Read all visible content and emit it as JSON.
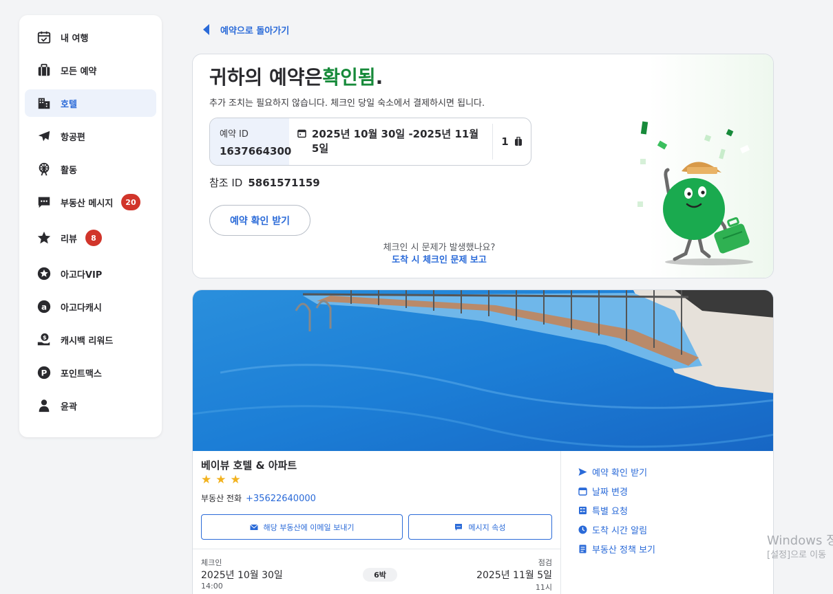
{
  "sidebar": {
    "items": [
      {
        "label": "내 여행",
        "icon": "calendar-check-icon"
      },
      {
        "label": "모든 예약",
        "icon": "suitcase-icon"
      },
      {
        "label": "호텔",
        "icon": "hotel-building-icon",
        "active": true
      },
      {
        "label": "항공편",
        "icon": "airplane-icon"
      },
      {
        "label": "활동",
        "icon": "ferris-wheel-icon"
      },
      {
        "label": "부동산 메시지",
        "icon": "chat-icon",
        "badge": "20"
      },
      {
        "label": "리뷰",
        "icon": "star-icon",
        "badge": "8"
      },
      {
        "label": "아고다VIP",
        "icon": "vip-star-icon"
      },
      {
        "label": "아고다캐시",
        "icon": "agoda-cash-icon"
      },
      {
        "label": "캐시백 리워드",
        "icon": "cashback-icon"
      },
      {
        "label": "포인트맥스",
        "icon": "pointsmax-icon"
      },
      {
        "label": "윤곽",
        "icon": "person-icon"
      }
    ]
  },
  "back_link": "예약으로 돌아가기",
  "confirmation": {
    "title_prefix": "귀하의 예약은",
    "title_status": "확인됨",
    "title_suffix": ".",
    "subtitle": "추가 조치는 필요하지 않습니다. 체크인 당일 숙소에서 결제하시면 됩니다.",
    "booking_id_label": "예약 ID",
    "booking_id": "1637664300",
    "dates": "2025년 10월 30일 -2025년 11월 5일",
    "guests": "1",
    "reference_label": "참조 ID",
    "reference_id": "5861571159",
    "confirm_button": "예약 확인 받기",
    "issue_question": "체크인 시 문제가 발생했나요?",
    "issue_link": "도착 시 체크인 문제 보고"
  },
  "hotel": {
    "name": "베이뷰 호텔 & 아파트",
    "stars": 3,
    "phone_label": "부동산 전화",
    "phone": "+35622640000",
    "email_button": "해당 부동산에 이메일 보내기",
    "message_button": "메시지 속성",
    "checkin_label": "체크인",
    "checkin_date": "2025년 10월 30일",
    "checkin_time": "14:00",
    "nights": "6박",
    "checkout_label": "점검",
    "checkout_date": "2025년 11월 5일",
    "checkout_time": "11시"
  },
  "hotel_actions": [
    {
      "label": "예약 확인 받기",
      "icon": "send-icon"
    },
    {
      "label": "날짜 변경",
      "icon": "calendar-icon"
    },
    {
      "label": "특별 요청",
      "icon": "checklist-icon"
    },
    {
      "label": "도착 시간 알림",
      "icon": "clock-icon"
    },
    {
      "label": "부동산 정책 보기",
      "icon": "document-icon"
    }
  ],
  "watermark": {
    "line1": "Windows 정",
    "line2": "[설정]으로 이동"
  },
  "colors": {
    "accent": "#2a6ad8",
    "confirmed_green": "#178a3a",
    "badge_red": "#d1352b",
    "star_yellow": "#f2b21f"
  }
}
